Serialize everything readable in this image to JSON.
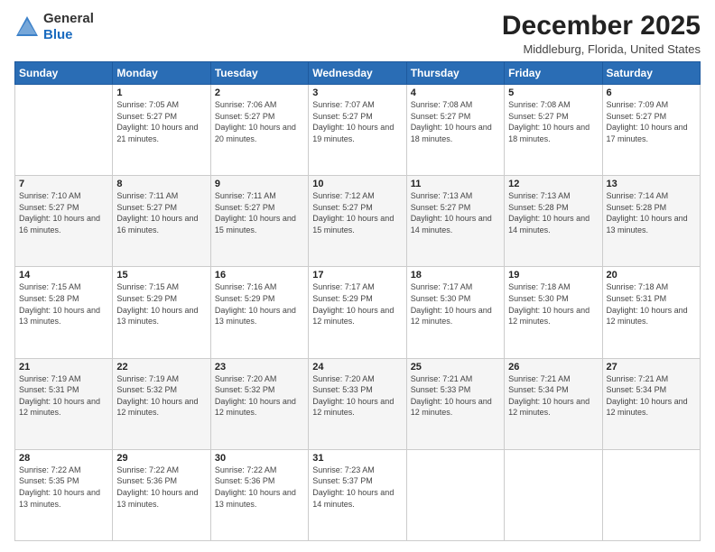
{
  "header": {
    "logo_general": "General",
    "logo_blue": "Blue",
    "month_title": "December 2025",
    "location": "Middleburg, Florida, United States"
  },
  "weekdays": [
    "Sunday",
    "Monday",
    "Tuesday",
    "Wednesday",
    "Thursday",
    "Friday",
    "Saturday"
  ],
  "weeks": [
    [
      {
        "day": "",
        "sunrise": "",
        "sunset": "",
        "daylight": ""
      },
      {
        "day": "1",
        "sunrise": "Sunrise: 7:05 AM",
        "sunset": "Sunset: 5:27 PM",
        "daylight": "Daylight: 10 hours and 21 minutes."
      },
      {
        "day": "2",
        "sunrise": "Sunrise: 7:06 AM",
        "sunset": "Sunset: 5:27 PM",
        "daylight": "Daylight: 10 hours and 20 minutes."
      },
      {
        "day": "3",
        "sunrise": "Sunrise: 7:07 AM",
        "sunset": "Sunset: 5:27 PM",
        "daylight": "Daylight: 10 hours and 19 minutes."
      },
      {
        "day": "4",
        "sunrise": "Sunrise: 7:08 AM",
        "sunset": "Sunset: 5:27 PM",
        "daylight": "Daylight: 10 hours and 18 minutes."
      },
      {
        "day": "5",
        "sunrise": "Sunrise: 7:08 AM",
        "sunset": "Sunset: 5:27 PM",
        "daylight": "Daylight: 10 hours and 18 minutes."
      },
      {
        "day": "6",
        "sunrise": "Sunrise: 7:09 AM",
        "sunset": "Sunset: 5:27 PM",
        "daylight": "Daylight: 10 hours and 17 minutes."
      }
    ],
    [
      {
        "day": "7",
        "sunrise": "Sunrise: 7:10 AM",
        "sunset": "Sunset: 5:27 PM",
        "daylight": "Daylight: 10 hours and 16 minutes."
      },
      {
        "day": "8",
        "sunrise": "Sunrise: 7:11 AM",
        "sunset": "Sunset: 5:27 PM",
        "daylight": "Daylight: 10 hours and 16 minutes."
      },
      {
        "day": "9",
        "sunrise": "Sunrise: 7:11 AM",
        "sunset": "Sunset: 5:27 PM",
        "daylight": "Daylight: 10 hours and 15 minutes."
      },
      {
        "day": "10",
        "sunrise": "Sunrise: 7:12 AM",
        "sunset": "Sunset: 5:27 PM",
        "daylight": "Daylight: 10 hours and 15 minutes."
      },
      {
        "day": "11",
        "sunrise": "Sunrise: 7:13 AM",
        "sunset": "Sunset: 5:27 PM",
        "daylight": "Daylight: 10 hours and 14 minutes."
      },
      {
        "day": "12",
        "sunrise": "Sunrise: 7:13 AM",
        "sunset": "Sunset: 5:28 PM",
        "daylight": "Daylight: 10 hours and 14 minutes."
      },
      {
        "day": "13",
        "sunrise": "Sunrise: 7:14 AM",
        "sunset": "Sunset: 5:28 PM",
        "daylight": "Daylight: 10 hours and 13 minutes."
      }
    ],
    [
      {
        "day": "14",
        "sunrise": "Sunrise: 7:15 AM",
        "sunset": "Sunset: 5:28 PM",
        "daylight": "Daylight: 10 hours and 13 minutes."
      },
      {
        "day": "15",
        "sunrise": "Sunrise: 7:15 AM",
        "sunset": "Sunset: 5:29 PM",
        "daylight": "Daylight: 10 hours and 13 minutes."
      },
      {
        "day": "16",
        "sunrise": "Sunrise: 7:16 AM",
        "sunset": "Sunset: 5:29 PM",
        "daylight": "Daylight: 10 hours and 13 minutes."
      },
      {
        "day": "17",
        "sunrise": "Sunrise: 7:17 AM",
        "sunset": "Sunset: 5:29 PM",
        "daylight": "Daylight: 10 hours and 12 minutes."
      },
      {
        "day": "18",
        "sunrise": "Sunrise: 7:17 AM",
        "sunset": "Sunset: 5:30 PM",
        "daylight": "Daylight: 10 hours and 12 minutes."
      },
      {
        "day": "19",
        "sunrise": "Sunrise: 7:18 AM",
        "sunset": "Sunset: 5:30 PM",
        "daylight": "Daylight: 10 hours and 12 minutes."
      },
      {
        "day": "20",
        "sunrise": "Sunrise: 7:18 AM",
        "sunset": "Sunset: 5:31 PM",
        "daylight": "Daylight: 10 hours and 12 minutes."
      }
    ],
    [
      {
        "day": "21",
        "sunrise": "Sunrise: 7:19 AM",
        "sunset": "Sunset: 5:31 PM",
        "daylight": "Daylight: 10 hours and 12 minutes."
      },
      {
        "day": "22",
        "sunrise": "Sunrise: 7:19 AM",
        "sunset": "Sunset: 5:32 PM",
        "daylight": "Daylight: 10 hours and 12 minutes."
      },
      {
        "day": "23",
        "sunrise": "Sunrise: 7:20 AM",
        "sunset": "Sunset: 5:32 PM",
        "daylight": "Daylight: 10 hours and 12 minutes."
      },
      {
        "day": "24",
        "sunrise": "Sunrise: 7:20 AM",
        "sunset": "Sunset: 5:33 PM",
        "daylight": "Daylight: 10 hours and 12 minutes."
      },
      {
        "day": "25",
        "sunrise": "Sunrise: 7:21 AM",
        "sunset": "Sunset: 5:33 PM",
        "daylight": "Daylight: 10 hours and 12 minutes."
      },
      {
        "day": "26",
        "sunrise": "Sunrise: 7:21 AM",
        "sunset": "Sunset: 5:34 PM",
        "daylight": "Daylight: 10 hours and 12 minutes."
      },
      {
        "day": "27",
        "sunrise": "Sunrise: 7:21 AM",
        "sunset": "Sunset: 5:34 PM",
        "daylight": "Daylight: 10 hours and 12 minutes."
      }
    ],
    [
      {
        "day": "28",
        "sunrise": "Sunrise: 7:22 AM",
        "sunset": "Sunset: 5:35 PM",
        "daylight": "Daylight: 10 hours and 13 minutes."
      },
      {
        "day": "29",
        "sunrise": "Sunrise: 7:22 AM",
        "sunset": "Sunset: 5:36 PM",
        "daylight": "Daylight: 10 hours and 13 minutes."
      },
      {
        "day": "30",
        "sunrise": "Sunrise: 7:22 AM",
        "sunset": "Sunset: 5:36 PM",
        "daylight": "Daylight: 10 hours and 13 minutes."
      },
      {
        "day": "31",
        "sunrise": "Sunrise: 7:23 AM",
        "sunset": "Sunset: 5:37 PM",
        "daylight": "Daylight: 10 hours and 14 minutes."
      },
      {
        "day": "",
        "sunrise": "",
        "sunset": "",
        "daylight": ""
      },
      {
        "day": "",
        "sunrise": "",
        "sunset": "",
        "daylight": ""
      },
      {
        "day": "",
        "sunrise": "",
        "sunset": "",
        "daylight": ""
      }
    ]
  ]
}
